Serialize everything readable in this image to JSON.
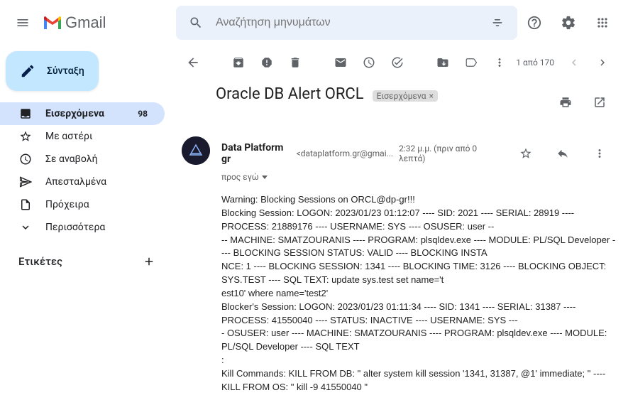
{
  "header": {
    "brand": "Gmail",
    "search_placeholder": "Αναζήτηση μηνυμάτων"
  },
  "compose_label": "Σύνταξη",
  "nav": {
    "inbox": "Εισερχόμενα",
    "inbox_count": "98",
    "starred": "Με αστέρι",
    "snoozed": "Σε αναβολή",
    "sent": "Απεσταλμένα",
    "drafts": "Πρόχειρα",
    "more": "Περισσότερα"
  },
  "labels_header": "Ετικέτες",
  "pagination": "1 από 170",
  "email": {
    "subject": "Oracle DB Alert ORCL",
    "tag": "Εισερχόμενα",
    "sender_name": "Data Platform gr",
    "sender_email": "<dataplatform.gr@gmai...",
    "time": "2:32 μ.μ. (πριν από 0 λεπτά)",
    "recipient": "προς εγώ",
    "body_lines": [
      "Warning: Blocking Sessions on ORCL@dp-gr!!!",
      "Blocking Session:  LOGON: 2023/01/23 01:12:07 ---- SID: 2021 ---- SERIAL: 28919 ---- PROCESS: 21889176 ---- USERNAME: SYS ---- OSUSER: user --",
      "-- MACHINE: SMATZOURANIS ---- PROGRAM: plsqldev.exe ---- MODULE: PL/SQL Developer ---- BLOCKING SESSION STATUS: VALID ---- BLOCKING INSTA",
      "NCE: 1 ---- BLOCKING SESSION: 1341 ---- BLOCKING TIME: 3126 ---- BLOCKING OBJECT: SYS.TEST ----                  SQL TEXT: update sys.test set name='t",
      "est10' where name='test2'",
      "   Blocker's Session:  LOGON: 2023/01/23 01:11:34 ---- SID: 1341 ---- SERIAL: 31387 ---- PROCESS: 41550040 ---- STATUS: INACTIVE ---- USERNAME: SYS ---",
      "- OSUSER: user ---- MACHINE: SMATZOURANIS ---- PROGRAM: plsqldev.exe ---- MODULE: PL/SQL Developer ----                  SQL TEXT",
      ":",
      "",
      "Kill Commands: KILL FROM DB: \" alter system kill session '1341, 31387, @1' immediate; \" ---- KILL FROM OS: \" kill -9 41550040 \""
    ]
  }
}
